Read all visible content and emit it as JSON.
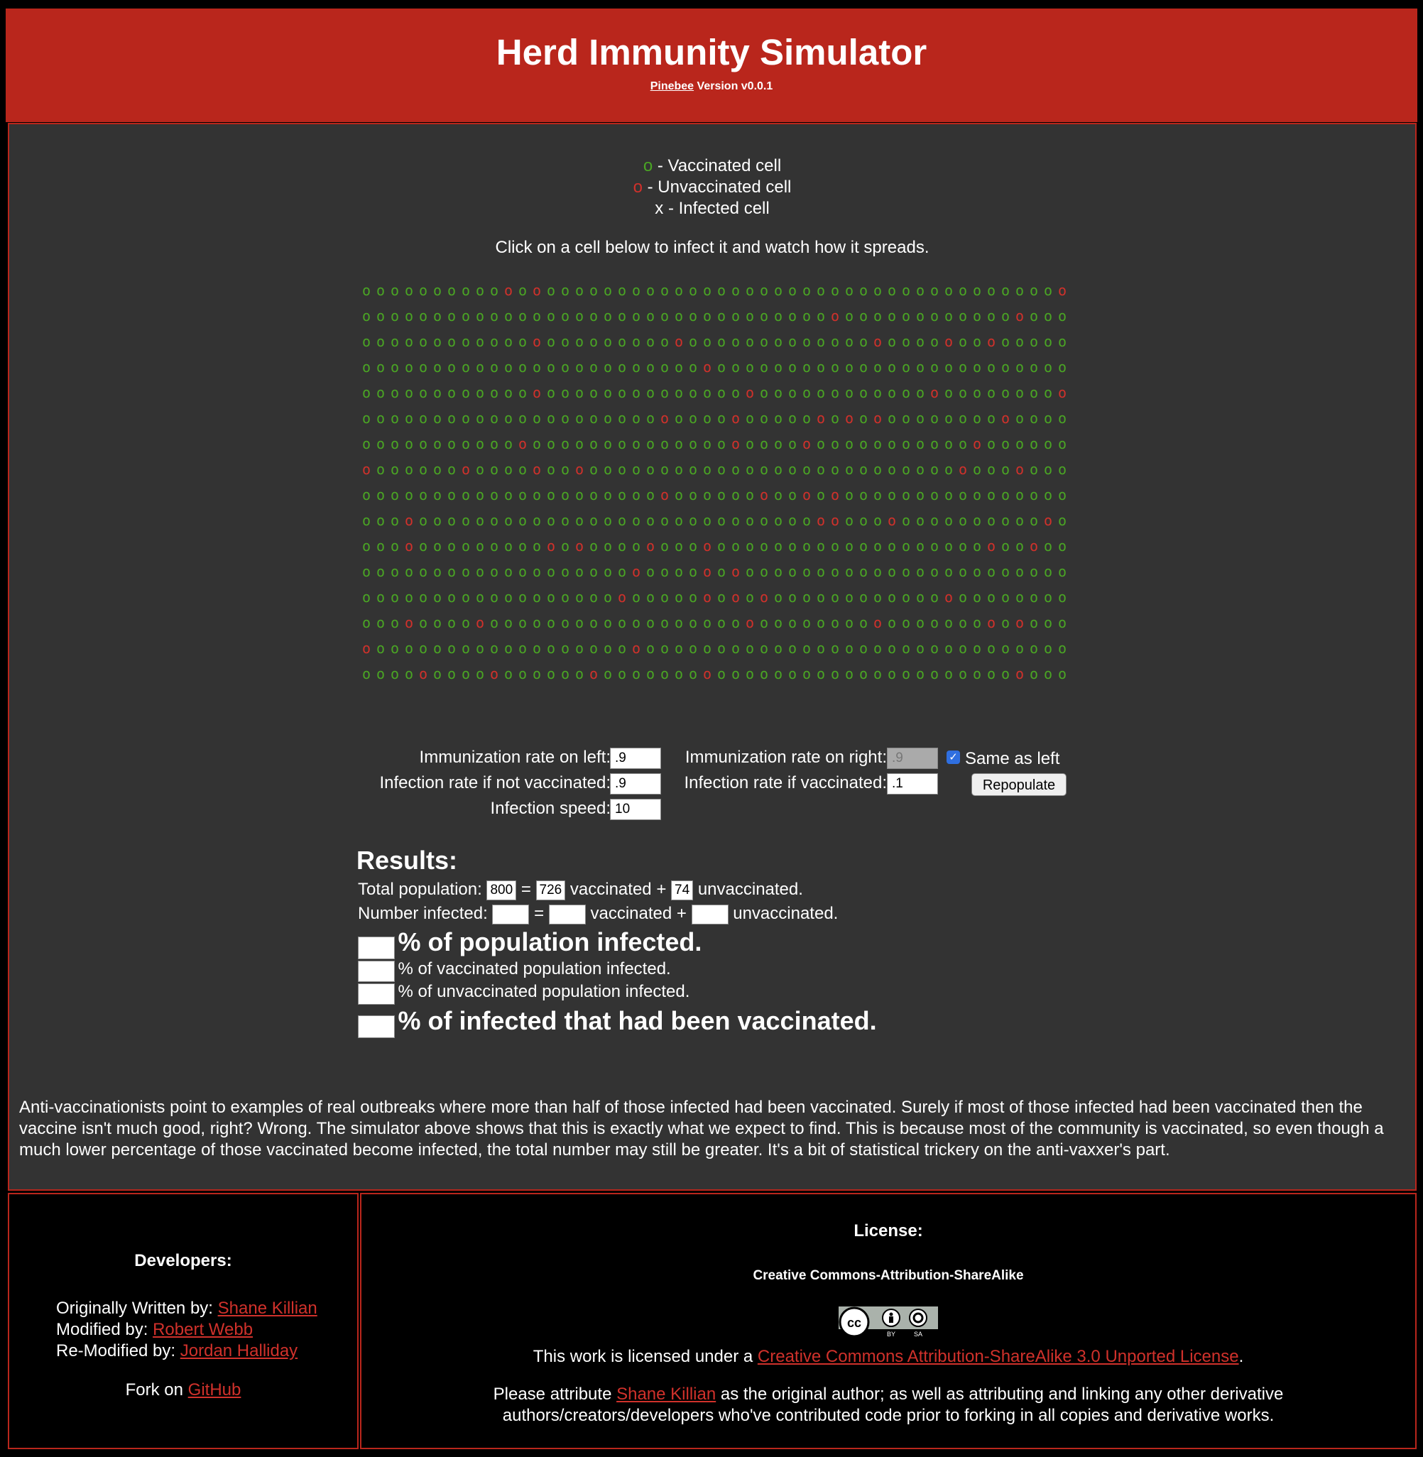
{
  "header": {
    "title": "Herd Immunity Simulator",
    "brand_link": "Pinebee",
    "version": "Version v0.0.1"
  },
  "legend": {
    "vaccinated_symbol": "o",
    "vaccinated_label": "- Vaccinated cell",
    "unvaccinated_symbol": "o",
    "unvaccinated_label": "- Unvaccinated cell",
    "infected_symbol": "x",
    "infected_label": "- Infected cell"
  },
  "instruction": "Click on a cell below to infect it and watch how it spreads.",
  "grid": {
    "columns": 50,
    "rows": 16,
    "cell_symbol": "o",
    "colors": {
      "vaccinated": "#4aa524",
      "unvaccinated": "#d0312b"
    },
    "unvaccinated_cells": [
      [
        0,
        10
      ],
      [
        0,
        12
      ],
      [
        0,
        49
      ],
      [
        1,
        33
      ],
      [
        1,
        46
      ],
      [
        2,
        12
      ],
      [
        2,
        22
      ],
      [
        2,
        36
      ],
      [
        2,
        41
      ],
      [
        2,
        44
      ],
      [
        3,
        24
      ],
      [
        4,
        12
      ],
      [
        4,
        27
      ],
      [
        4,
        40
      ],
      [
        4,
        49
      ],
      [
        5,
        21
      ],
      [
        5,
        26
      ],
      [
        5,
        32
      ],
      [
        5,
        34
      ],
      [
        5,
        36
      ],
      [
        5,
        45
      ],
      [
        6,
        11
      ],
      [
        6,
        26
      ],
      [
        6,
        31
      ],
      [
        6,
        43
      ],
      [
        7,
        0
      ],
      [
        7,
        7
      ],
      [
        7,
        12
      ],
      [
        7,
        15
      ],
      [
        7,
        42
      ],
      [
        7,
        46
      ],
      [
        8,
        21
      ],
      [
        8,
        28
      ],
      [
        8,
        31
      ],
      [
        8,
        33
      ],
      [
        9,
        3
      ],
      [
        9,
        32
      ],
      [
        9,
        33
      ],
      [
        9,
        37
      ],
      [
        9,
        48
      ],
      [
        10,
        3
      ],
      [
        10,
        13
      ],
      [
        10,
        15
      ],
      [
        10,
        20
      ],
      [
        10,
        24
      ],
      [
        10,
        44
      ],
      [
        10,
        47
      ],
      [
        11,
        19
      ],
      [
        11,
        24
      ],
      [
        11,
        26
      ],
      [
        12,
        18
      ],
      [
        12,
        24
      ],
      [
        12,
        26
      ],
      [
        12,
        28
      ],
      [
        12,
        41
      ],
      [
        13,
        3
      ],
      [
        13,
        8
      ],
      [
        13,
        27
      ],
      [
        13,
        36
      ],
      [
        13,
        44
      ],
      [
        13,
        46
      ],
      [
        14,
        0
      ],
      [
        14,
        19
      ],
      [
        15,
        4
      ],
      [
        15,
        9
      ],
      [
        15,
        16
      ],
      [
        15,
        24
      ],
      [
        15,
        46
      ]
    ]
  },
  "controls": {
    "immunization_left_label": "Immunization rate on left:",
    "immunization_left_value": ".9",
    "immunization_right_label": "Immunization rate on right:",
    "immunization_right_value": ".9",
    "same_as_left_label": "Same as left",
    "infection_not_vacc_label": "Infection rate if not vaccinated:",
    "infection_not_vacc_value": ".9",
    "infection_vacc_label": "Infection rate if vaccinated:",
    "infection_vacc_value": ".1",
    "repopulate_label": "Repopulate",
    "infection_speed_label": "Infection speed:",
    "infection_speed_value": "10"
  },
  "results": {
    "heading": "Results:",
    "total_population_label": "Total population:",
    "total_population": "800",
    "vaccinated_count": "726",
    "unvaccinated_count": "74",
    "equals": "=",
    "plus_vaccinated": "vaccinated +",
    "unvaccinated_suffix": "unvaccinated.",
    "number_infected_label": "Number infected:",
    "pct_population": "% of population infected.",
    "pct_vaccinated": "% of vaccinated population infected.",
    "pct_unvaccinated": "% of unvaccinated population infected.",
    "pct_infected_vaccinated": "% of infected that had been vaccinated."
  },
  "explanation": "Anti-vaccinationists point to examples of real outbreaks where more than half of those infected had been vaccinated. Surely if most of those infected had been vaccinated then the vaccine isn't much good, right? Wrong. The simulator above shows that this is exactly what we expect to find. This is because most of the community is vaccinated, so even though a much lower percentage of those vaccinated become infected, the total number may still be greater. It's a bit of statistical trickery on the anti-vaxxer's part.",
  "developers": {
    "heading": "Developers:",
    "original_label": "Originally Written by:",
    "original_name": "Shane Killian",
    "modified_label": "Modified by:",
    "modified_name": "Robert Webb",
    "remodified_label": "Re-Modified by:",
    "remodified_name": "Jordan Halliday",
    "fork_label": "Fork on",
    "fork_link": "GitHub"
  },
  "license": {
    "heading": "License:",
    "name": "Creative Commons-Attribution-ShareAlike",
    "badge_by": "BY",
    "badge_sa": "SA",
    "text_prefix": "This work is licensed under a",
    "link": "Creative Commons Attribution-ShareAlike 3.0 Unported License",
    "text_suffix": ".",
    "attribute_prefix": "Please attribute",
    "attribute_name": "Shane Killian",
    "attribute_suffix": "as the original author; as well as attributing and linking any other derivative authors/creators/developers who've contributed code prior to forking in all copies and derivative works."
  }
}
